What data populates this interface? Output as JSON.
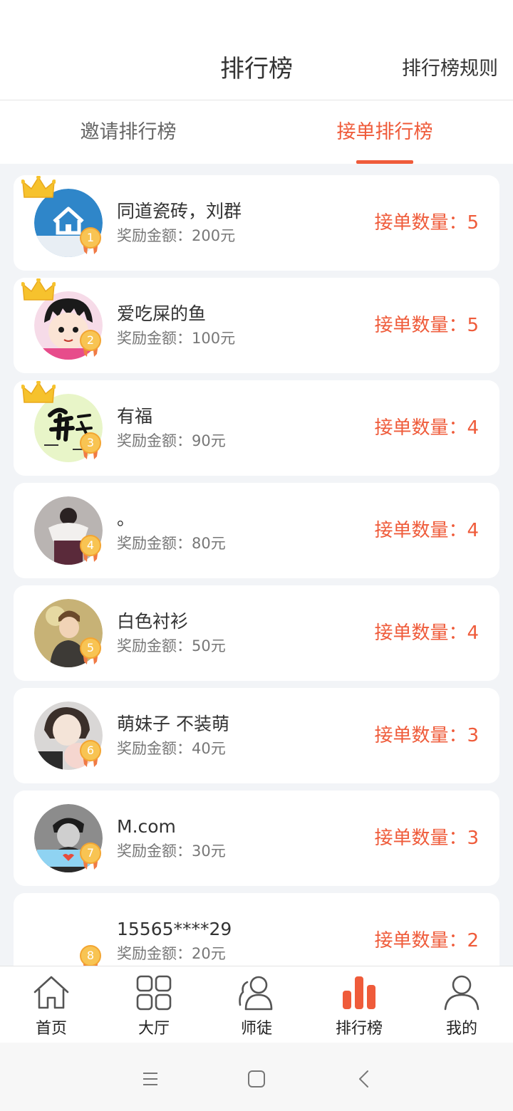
{
  "header": {
    "title": "排行榜",
    "rules_link": "排行榜规则"
  },
  "tabs": [
    {
      "label": "邀请排行榜",
      "active": false
    },
    {
      "label": "接单排行榜",
      "active": true
    }
  ],
  "colors": {
    "accent": "#ef5b3a",
    "medal": "#f8c453",
    "crown": "#f6c22d",
    "background": "#f2f4f7"
  },
  "ranking": [
    {
      "rank": "1",
      "name": "同道瓷砖，刘群",
      "reward": "奖励金额：200元",
      "count": "接单数量：5",
      "crown": true,
      "avatar_icon": "house-icon"
    },
    {
      "rank": "2",
      "name": "爱吃屎的鱼",
      "reward": "奖励金额：100元",
      "count": "接单数量：5",
      "crown": true,
      "avatar_icon": "cartoon-girl-avatar"
    },
    {
      "rank": "3",
      "name": "有福",
      "reward": "奖励金额：90元",
      "count": "接单数量：4",
      "crown": true,
      "avatar_icon": "calligraphy-avatar"
    },
    {
      "rank": "4",
      "name": "。",
      "reward": "奖励金额：80元",
      "count": "接单数量：4",
      "crown": false,
      "avatar_icon": "photo-avatar"
    },
    {
      "rank": "5",
      "name": "白色衬衫",
      "reward": "奖励金额：50元",
      "count": "接单数量：4",
      "crown": false,
      "avatar_icon": "photo-avatar"
    },
    {
      "rank": "6",
      "name": "萌妹子 不装萌",
      "reward": "奖励金额：40元",
      "count": "接单数量：3",
      "crown": false,
      "avatar_icon": "photo-avatar"
    },
    {
      "rank": "7",
      "name": "M.com",
      "reward": "奖励金额：30元",
      "count": "接单数量：3",
      "crown": false,
      "avatar_icon": "photo-avatar"
    },
    {
      "rank": "8",
      "name": "15565****29",
      "reward": "奖励金额：20元",
      "count": "接单数量：2",
      "crown": false,
      "avatar_icon": "blank-avatar"
    }
  ],
  "tabbar": [
    {
      "label": "首页",
      "icon": "home-icon",
      "active": false
    },
    {
      "label": "大厅",
      "icon": "grid-icon",
      "active": false
    },
    {
      "label": "师徒",
      "icon": "users-icon",
      "active": false
    },
    {
      "label": "排行榜",
      "icon": "bar-chart-icon",
      "active": true
    },
    {
      "label": "我的",
      "icon": "person-icon",
      "active": false
    }
  ],
  "system_nav": [
    "menu-icon",
    "home-square-icon",
    "back-icon"
  ]
}
